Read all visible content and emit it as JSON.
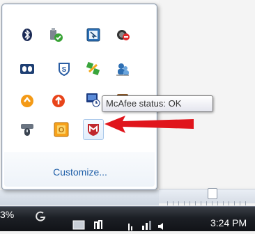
{
  "tooltip": {
    "text": "McAfee status: OK"
  },
  "flyout": {
    "customize_label": "Customize...",
    "icons": [
      {
        "name": "bluetooth-icon"
      },
      {
        "name": "usb-safely-remove-icon"
      },
      {
        "name": "display-settings-icon"
      },
      {
        "name": "network-disconnected-icon"
      },
      {
        "name": "dolby-audio-icon"
      },
      {
        "name": "shield-s-icon"
      },
      {
        "name": "puzzle-app-icon"
      },
      {
        "name": "network-people-icon"
      },
      {
        "name": "orange-update-icon"
      },
      {
        "name": "up-arrow-update-icon"
      },
      {
        "name": "monitor-app-icon"
      },
      {
        "name": "brown-app-icon"
      },
      {
        "name": "mouse-device-icon"
      },
      {
        "name": "office-icon"
      },
      {
        "name": "mcafee-icon"
      }
    ]
  },
  "taskbar": {
    "battery_percent": "3%",
    "time": "3:24 PM"
  },
  "colors": {
    "arrow": "#e0151c",
    "link": "#1f5fa8"
  }
}
